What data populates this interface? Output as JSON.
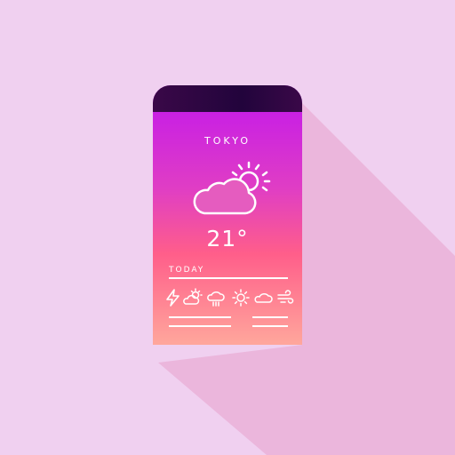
{
  "weather": {
    "city": "TOKYO",
    "temperature": "21°",
    "condition_icon": "partly-sunny-icon",
    "section_label": "TODAY",
    "forecast_icons": [
      "lightning-icon",
      "sun-cloud-icon",
      "rain-cloud-icon",
      "sun-icon",
      "cloud-icon",
      "wind-icon"
    ]
  },
  "colors": {
    "background": "#f0d0f0",
    "gradient_top": "#c116ee",
    "gradient_bottom": "#ffa79c",
    "topbar": "#2a0540"
  }
}
